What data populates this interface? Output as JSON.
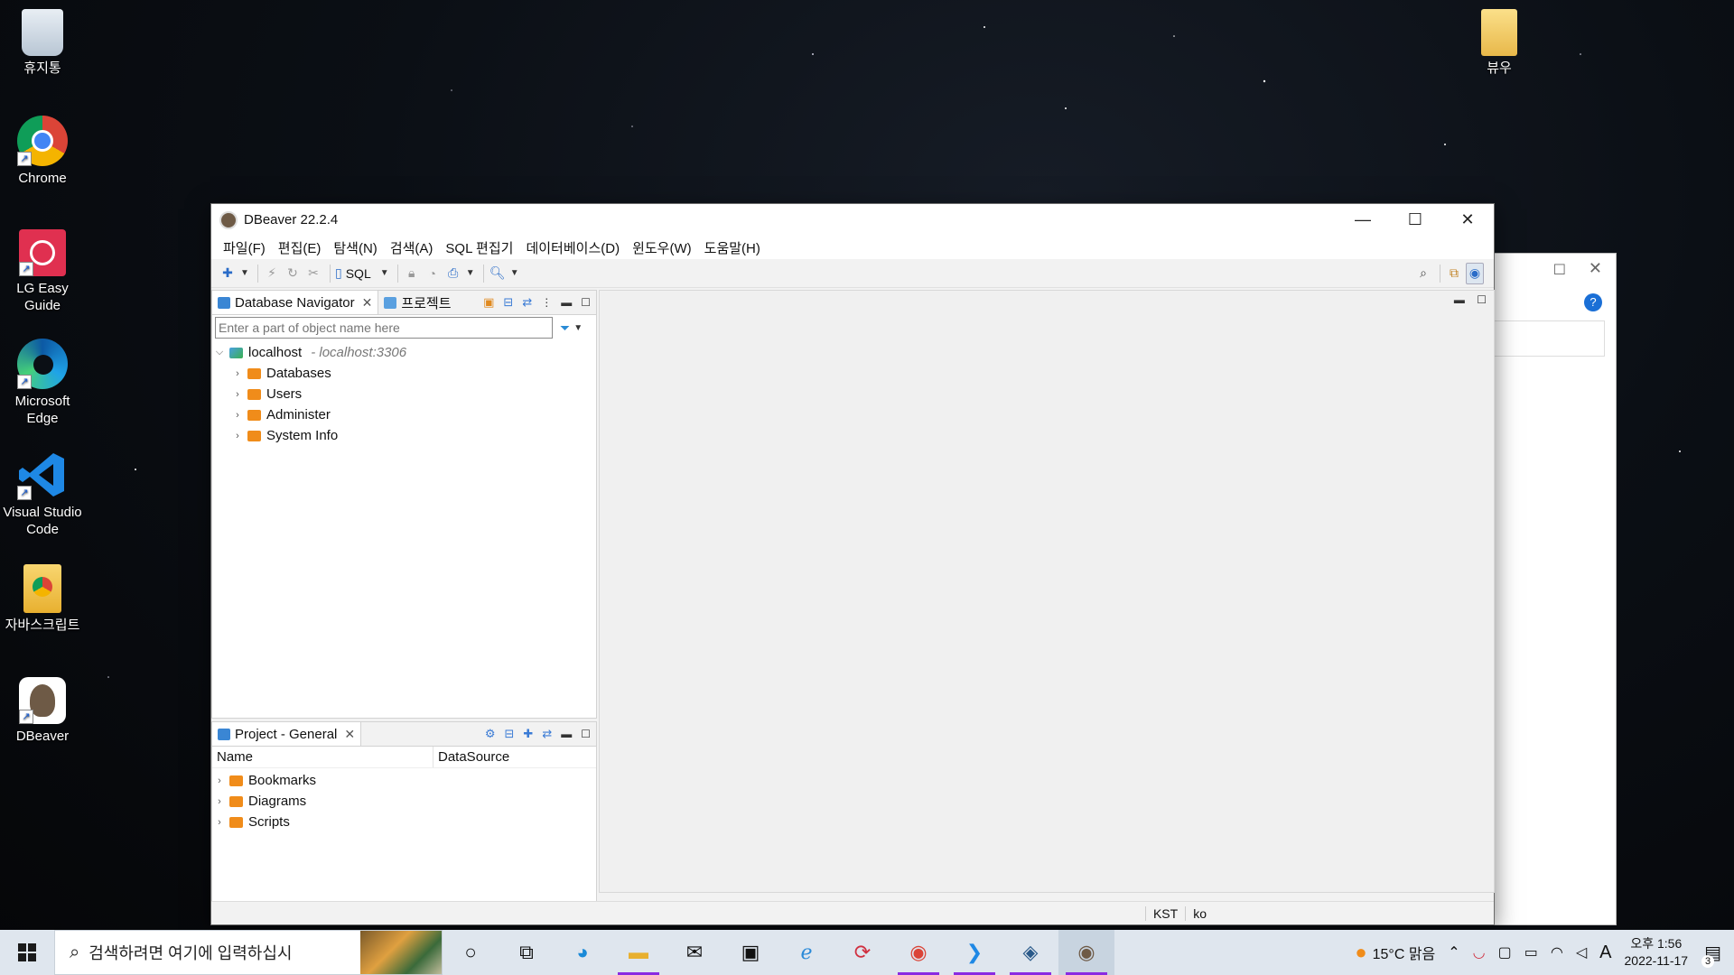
{
  "desktop": {
    "icons": [
      {
        "label": "휴지통",
        "icon": "recycle-bin-icon"
      },
      {
        "label": "Chrome",
        "icon": "chrome-icon"
      },
      {
        "label": "LG Easy Guide",
        "icon": "lg-easy-guide-icon"
      },
      {
        "label": "Microsoft Edge",
        "icon": "edge-icon"
      },
      {
        "label": "Visual Studio Code",
        "icon": "vscode-icon"
      },
      {
        "label": "자바스크립트",
        "icon": "javascript-folder-icon"
      },
      {
        "label": "DBeaver",
        "icon": "dbeaver-icon"
      },
      {
        "label": "뷰우",
        "icon": "folder-icon"
      }
    ]
  },
  "window": {
    "title": "DBeaver 22.2.4",
    "menu": [
      "파일(F)",
      "편집(E)",
      "탐색(N)",
      "검색(A)",
      "SQL 편집기",
      "데이터베이스(D)",
      "윈도우(W)",
      "도움말(H)"
    ],
    "toolbar": {
      "sql_label": "SQL"
    }
  },
  "navigator": {
    "tab_label": "Database Navigator",
    "projects_tab_label": "프로젝트",
    "filter_placeholder": "Enter a part of object name here",
    "connection": {
      "name": "localhost",
      "detail": "- localhost:3306"
    },
    "children": [
      "Databases",
      "Users",
      "Administer",
      "System Info"
    ]
  },
  "project": {
    "tab_label": "Project - General",
    "columns": [
      "Name",
      "DataSource"
    ],
    "items": [
      "Bookmarks",
      "Diagrams",
      "Scripts"
    ]
  },
  "status": {
    "timezone": "KST",
    "locale": "ko"
  },
  "taskbar": {
    "search_placeholder": "검색하려면 여기에 입력하십시",
    "weather": "15°C 맑음",
    "time": "오후 1:56",
    "date": "2022-11-17",
    "notification_count": "3",
    "ime": "A"
  },
  "colors": {
    "accent": "#2a6cc8",
    "folder_orange": "#f08c1a",
    "taskbar": "#dfe6ee"
  }
}
